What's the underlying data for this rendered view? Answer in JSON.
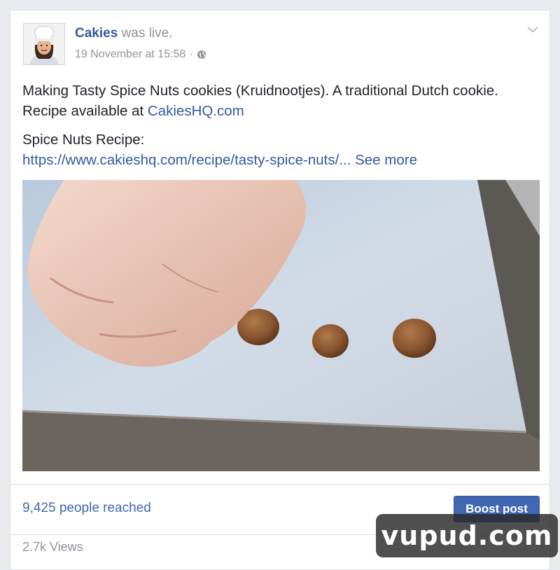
{
  "post": {
    "page_name": "Cakies",
    "action": "was live.",
    "timestamp": "19 November at 15:58",
    "separator": "·",
    "privacy_icon": "globe-icon",
    "menu_icon": "chevron-down-icon"
  },
  "body": {
    "line1": "Making Tasty Spice Nuts cookies (Kruidnootjes). A traditional Dutch cookie.",
    "line2_prefix": "Recipe available at ",
    "line2_link": "CakiesHQ.com",
    "recipe_heading": "Spice Nuts Recipe:",
    "recipe_url": "https://www.cakieshq.com/recipe/tasty-spice-nuts/...",
    "see_more": "See more"
  },
  "video": {
    "description": "Hand placing spice nut dough balls on baking paper in a tray"
  },
  "footer": {
    "reach": "9,425 people reached",
    "boost_label": "Boost post",
    "views": "2.7k Views"
  },
  "watermark": "vupud.com",
  "colors": {
    "link": "#365899",
    "button": "#4267b2",
    "muted": "#90949c",
    "text": "#1d2129"
  }
}
